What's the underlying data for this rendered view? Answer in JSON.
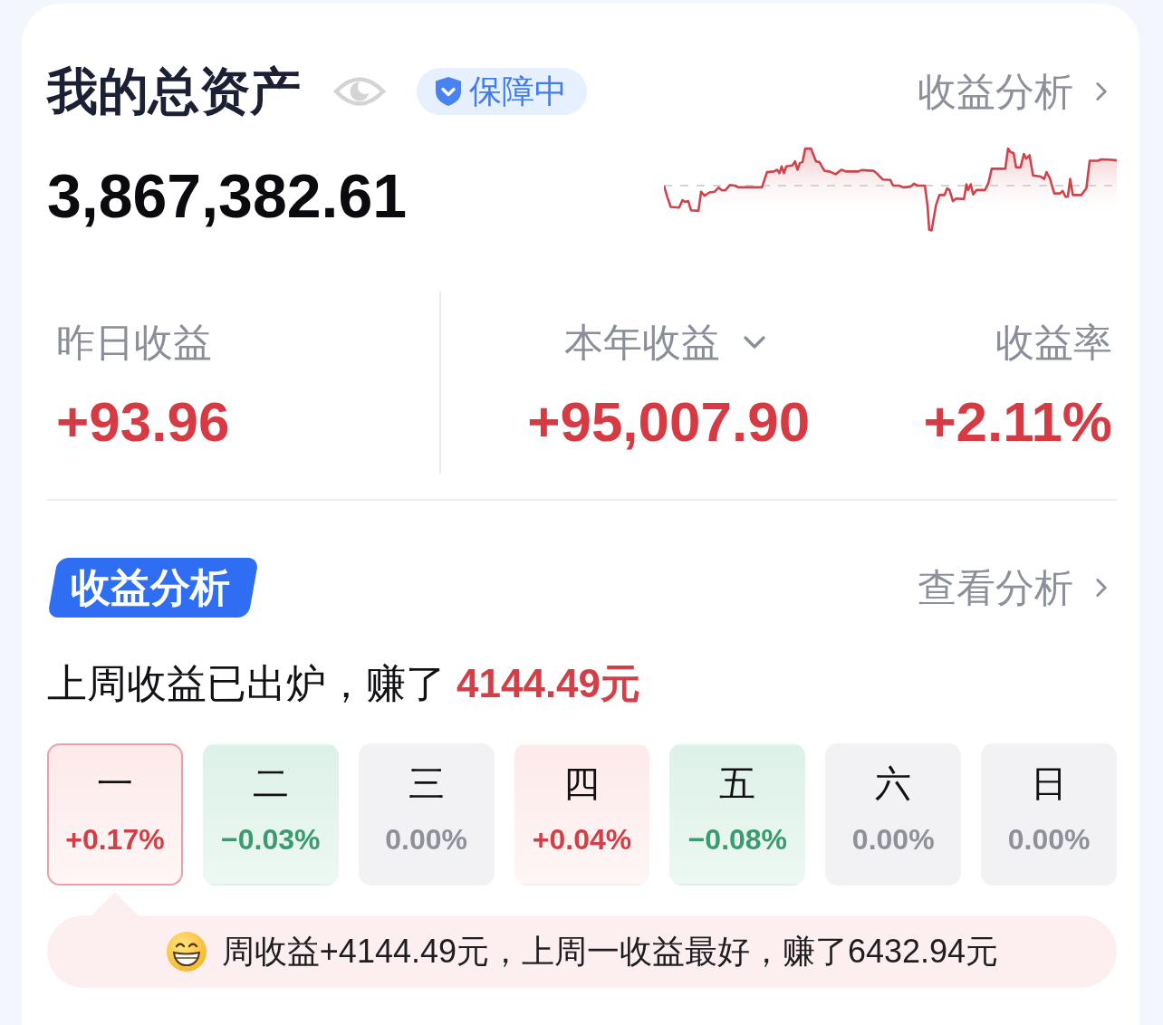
{
  "header": {
    "title": "我的总资产",
    "badge": "保障中",
    "link": "收益分析"
  },
  "total": {
    "amount": "3,867,382.61"
  },
  "stats": [
    {
      "label": "昨日收益",
      "value": "+93.96",
      "dropdown": false
    },
    {
      "label": "本年收益",
      "value": "+95,007.90",
      "dropdown": true
    },
    {
      "label": "收益率",
      "value": "+2.11%",
      "dropdown": false
    }
  ],
  "analysis": {
    "tag": "收益分析",
    "link": "查看分析",
    "summary": {
      "text": "上周收益已出炉，赚了",
      "amount": "4144.49元"
    },
    "days": [
      {
        "label": "一",
        "value": "+0.17%",
        "kind": "up",
        "selected": true
      },
      {
        "label": "二",
        "value": "−0.03%",
        "kind": "down",
        "selected": false
      },
      {
        "label": "三",
        "value": "0.00%",
        "kind": "flat",
        "selected": false
      },
      {
        "label": "四",
        "value": "+0.04%",
        "kind": "up",
        "selected": false
      },
      {
        "label": "五",
        "value": "−0.08%",
        "kind": "down",
        "selected": false
      },
      {
        "label": "六",
        "value": "0.00%",
        "kind": "flat",
        "selected": false
      },
      {
        "label": "日",
        "value": "0.00%",
        "kind": "flat",
        "selected": false
      }
    ],
    "tip": "周收益+4144.49元，上周一收益最好，赚了6432.94元"
  }
}
